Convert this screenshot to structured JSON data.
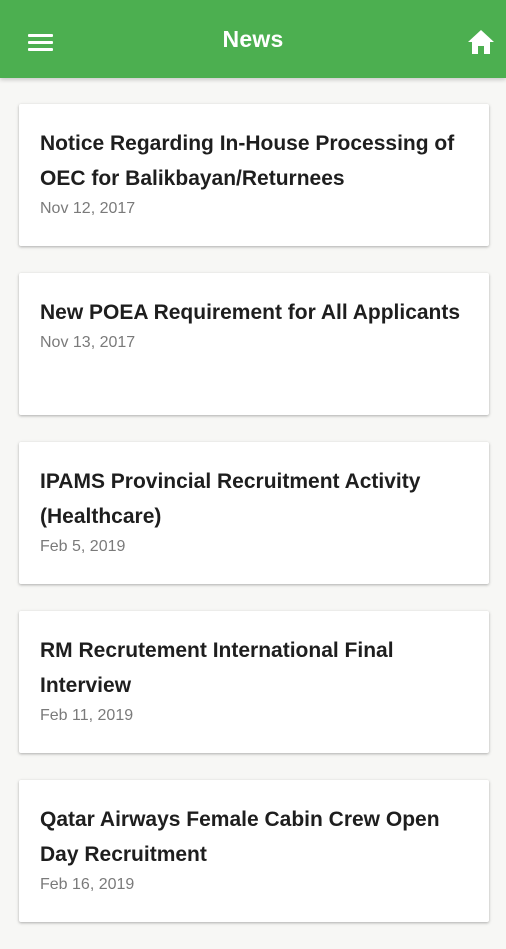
{
  "header": {
    "title": "News",
    "menu_icon": "hamburger-menu-icon",
    "home_icon": "home-icon",
    "color": "#4caf50"
  },
  "news": [
    {
      "title": "Notice Regarding In-House Processing of OEC for Balikbayan/Returnees",
      "date": "Nov 12, 2017"
    },
    {
      "title": "New POEA Requirement for All Applicants",
      "date": "Nov 13, 2017"
    },
    {
      "title": "IPAMS Provincial Recruitment Activity (Healthcare)",
      "date": "Feb 5, 2019"
    },
    {
      "title": "RM Recrutement International Final Interview",
      "date": "Feb 11, 2019"
    },
    {
      "title": "Qatar Airways Female Cabin Crew Open Day Recruitment",
      "date": "Feb 16, 2019"
    }
  ]
}
